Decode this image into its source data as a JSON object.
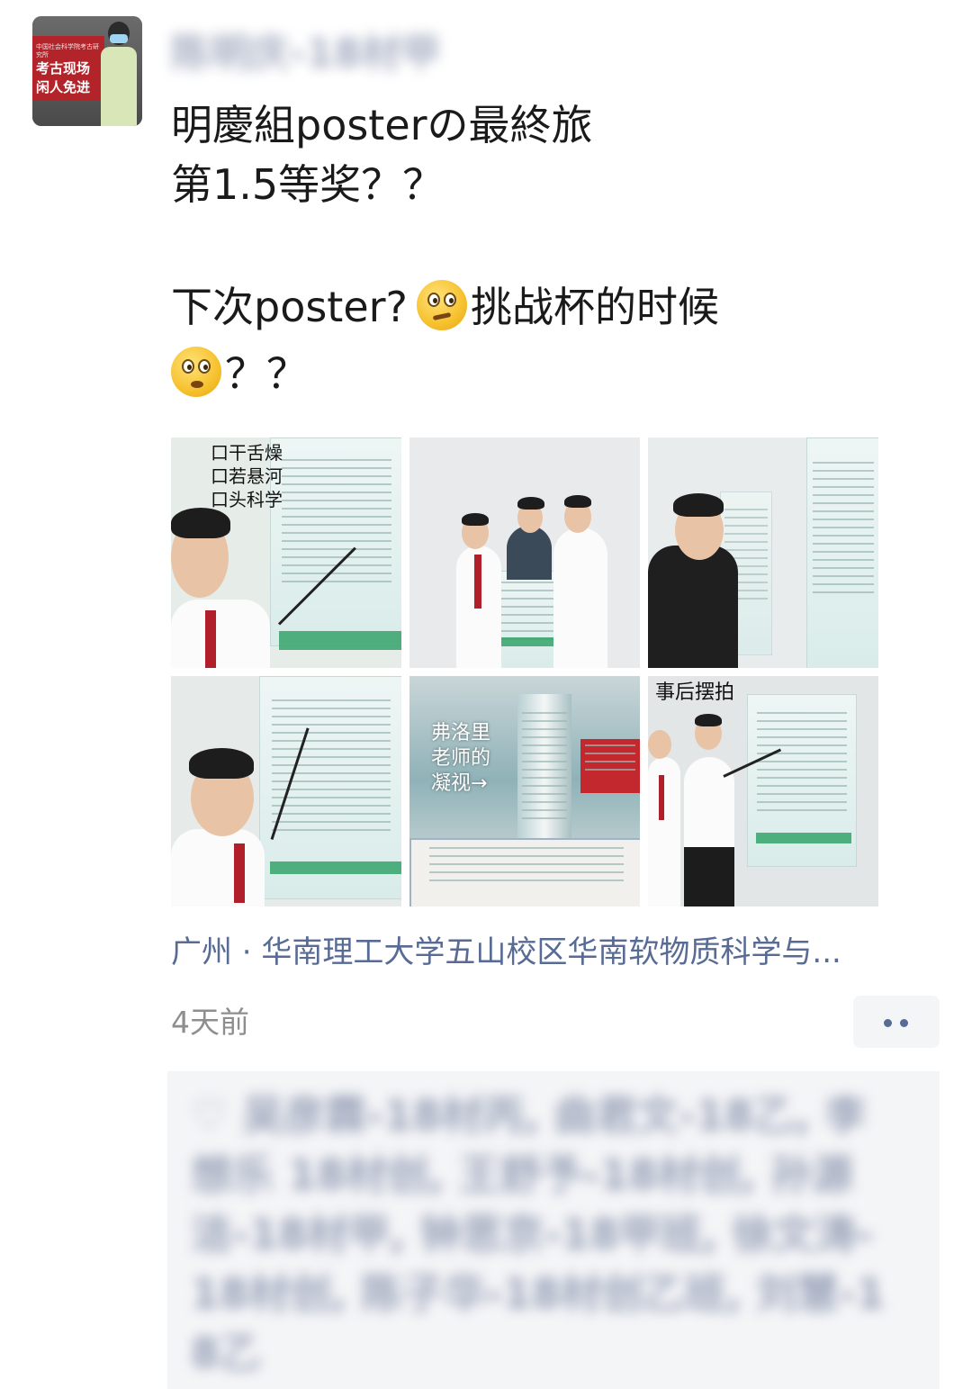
{
  "post": {
    "nickname": "陈明庆-18材甲",
    "avatar": {
      "sign_small": "中国社会科学院考古研究所",
      "sign_line1": "考古现场",
      "sign_line2": "闲人免进"
    },
    "content": {
      "line1": "明慶組posterの最終旅",
      "line2": "第1.5等奖？？",
      "line3_before": "下次poster?",
      "line3_after": "挑战杯的时候",
      "line4_after": "？？"
    },
    "emojis": [
      "thinking-face-emoji",
      "surprised-face-emoji"
    ],
    "photos": [
      {
        "caption": "口干舌燥\n口若悬河\n口头科学"
      },
      {
        "caption": ""
      },
      {
        "caption": ""
      },
      {
        "caption": ""
      },
      {
        "caption": "弗洛里\n老师的\n凝视→"
      },
      {
        "caption": "事后摆拍"
      }
    ],
    "location": "广州 · 华南理工大学五山校区华南软物质科学与...",
    "time": "4天前",
    "likes": "♡ 吴彦霖-18材丙, 曲君文-18乙, 李想乐 18材创, 王舒予-18材创, 孙源洁-18材甲, 钟思京-18甲班, 徐文涛-18材创, 陈子华-18材创乙班, 刘慧-18乙"
  },
  "colors": {
    "link": "#576b95",
    "time": "#8e8e8e",
    "likes_bg": "#f4f5f7",
    "poster_green": "#35a36b",
    "tie_red": "#b01f2a"
  }
}
